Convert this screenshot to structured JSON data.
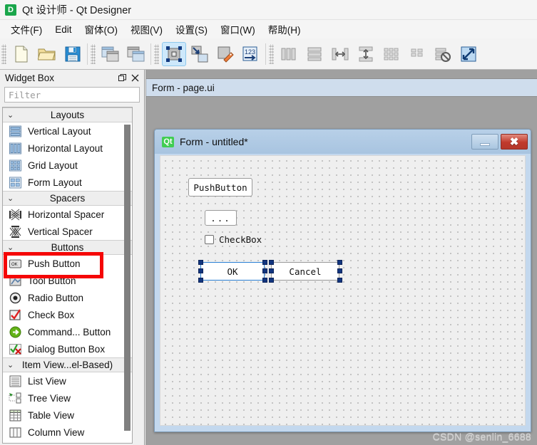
{
  "titlebar": {
    "icon": "designer-app-icon",
    "title": "Qt 设计师 - Qt Designer"
  },
  "menubar": {
    "items": [
      {
        "label": "文件(F)",
        "name": "menu-file"
      },
      {
        "label": "Edit",
        "name": "menu-edit"
      },
      {
        "label": "窗体(O)",
        "name": "menu-form"
      },
      {
        "label": "视图(V)",
        "name": "menu-view"
      },
      {
        "label": "设置(S)",
        "name": "menu-settings"
      },
      {
        "label": "窗口(W)",
        "name": "menu-window"
      },
      {
        "label": "帮助(H)",
        "name": "menu-help"
      }
    ]
  },
  "toolbar": {
    "groups": [
      {
        "buttons": [
          {
            "icon": "new-file-icon",
            "label": "New"
          },
          {
            "icon": "open-folder-icon",
            "label": "Open"
          },
          {
            "icon": "save-floppy-icon",
            "label": "Save"
          }
        ]
      },
      {
        "buttons": [
          {
            "icon": "cascade-windows-icon",
            "label": "Cascade"
          },
          {
            "icon": "tile-windows-icon",
            "label": "Tile"
          }
        ]
      },
      {
        "buttons": [
          {
            "icon": "edit-widgets-icon",
            "label": "Edit Widgets",
            "active": true
          },
          {
            "icon": "edit-signals-slots-icon",
            "label": "Edit Signals/Slots"
          },
          {
            "icon": "edit-buddies-icon",
            "label": "Edit Buddies"
          },
          {
            "icon": "edit-tab-order-icon",
            "label": "Edit Tab Order"
          }
        ]
      },
      {
        "buttons": [
          {
            "icon": "layout-horizontal-icon",
            "label": "Lay Out Horizontally"
          },
          {
            "icon": "layout-vertical-icon",
            "label": "Lay Out Vertically"
          },
          {
            "icon": "layout-splitter-h-icon",
            "label": "Lay Out in a Splitter Horizontally"
          },
          {
            "icon": "layout-splitter-v-icon",
            "label": "Lay Out in a Splitter Vertically"
          },
          {
            "icon": "layout-grid-icon",
            "label": "Lay Out in a Grid"
          },
          {
            "icon": "layout-form-icon",
            "label": "Lay Out in a Form Layout"
          },
          {
            "icon": "break-layout-icon",
            "label": "Break Layout"
          },
          {
            "icon": "adjust-size-icon",
            "label": "Adjust Size",
            "enabled": true
          }
        ]
      }
    ]
  },
  "widget_box": {
    "title": "Widget Box",
    "float_button": "float-icon",
    "close_button": "close-icon",
    "filter": {
      "value": "",
      "placeholder": "Filter"
    },
    "groups": [
      {
        "label": "Layouts",
        "expanded": true,
        "items": [
          {
            "label": "Vertical Layout",
            "icon": "vertical-layout-icon"
          },
          {
            "label": "Horizontal Layout",
            "icon": "horizontal-layout-icon"
          },
          {
            "label": "Grid Layout",
            "icon": "grid-layout-icon"
          },
          {
            "label": "Form Layout",
            "icon": "form-layout-icon"
          }
        ]
      },
      {
        "label": "Spacers",
        "expanded": true,
        "items": [
          {
            "label": "Horizontal Spacer",
            "icon": "horizontal-spacer-icon"
          },
          {
            "label": "Vertical Spacer",
            "icon": "vertical-spacer-icon"
          }
        ]
      },
      {
        "label": "Buttons",
        "expanded": true,
        "items": [
          {
            "label": "Push Button",
            "icon": "push-button-icon",
            "highlighted": true
          },
          {
            "label": "Tool Button",
            "icon": "tool-button-icon"
          },
          {
            "label": "Radio Button",
            "icon": "radio-button-icon"
          },
          {
            "label": "Check Box",
            "icon": "check-box-icon"
          },
          {
            "label": "Command... Button",
            "icon": "command-link-button-icon"
          },
          {
            "label": "Dialog Button Box",
            "icon": "dialog-button-box-icon"
          }
        ]
      },
      {
        "label": "Item View...el-Based)",
        "expanded": true,
        "items": [
          {
            "label": "List View",
            "icon": "list-view-icon"
          },
          {
            "label": "Tree View",
            "icon": "tree-view-icon"
          },
          {
            "label": "Table View",
            "icon": "table-view-icon"
          },
          {
            "label": "Column View",
            "icon": "column-view-icon"
          }
        ]
      }
    ]
  },
  "mdi": {
    "tab_label": "Form - page.ui",
    "form_window": {
      "icon": "qt-logo-icon",
      "title": "Form - untitled*",
      "minimize_label": "minimize-icon",
      "close_label": "✖",
      "widgets": [
        {
          "type": "pushbutton",
          "name": "pushbutton-widget",
          "text": "PushButton",
          "selected": false
        },
        {
          "type": "toolbutton",
          "name": "toolbutton-widget",
          "text": "...",
          "selected": false
        },
        {
          "type": "checkbox",
          "name": "checkbox-widget",
          "text": "CheckBox",
          "selected": false
        },
        {
          "type": "pushbutton",
          "name": "ok-button-widget",
          "text": "OK",
          "selected": true
        },
        {
          "type": "pushbutton",
          "name": "cancel-button-widget",
          "text": "Cancel",
          "selected": true
        }
      ]
    }
  },
  "watermark": "CSDN @senlin_6688",
  "colors": {
    "accent": "#2a7fd4",
    "selection_handle": "#12357f",
    "annotation": "#f50606",
    "titlebar_bg": "#f5f5f5",
    "mdi_bg": "#a0a0a0",
    "tab_bg": "#cfdded"
  }
}
